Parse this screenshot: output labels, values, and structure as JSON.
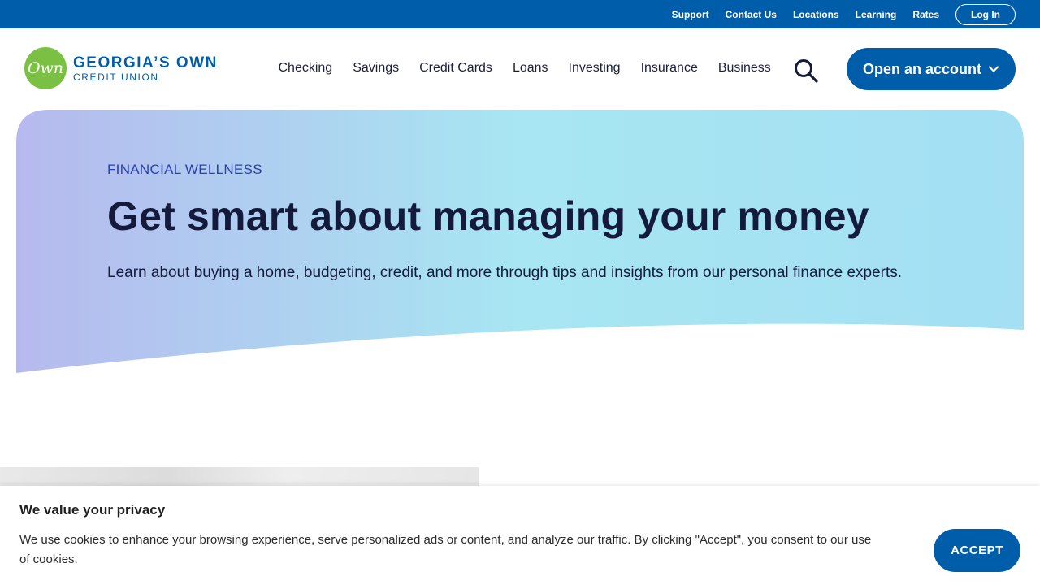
{
  "colors": {
    "brand_blue": "#005daa",
    "brand_green": "#7ac143",
    "heading_navy": "#141a3c",
    "eyebrow_blue": "#2a3fb0"
  },
  "utility_nav": {
    "links": [
      "Support",
      "Contact Us",
      "Locations",
      "Learning",
      "Rates"
    ],
    "login_label": "Log In"
  },
  "logo": {
    "mark": "Own",
    "line1": "GEORGIA’S OWN",
    "line2": "CREDIT UNION"
  },
  "main_nav": {
    "items": [
      "Checking",
      "Savings",
      "Credit Cards",
      "Loans",
      "Investing",
      "Insurance",
      "Business"
    ],
    "search_icon": "search-icon",
    "open_account_label": "Open an account",
    "open_account_icon": "chevron-down-icon"
  },
  "hero": {
    "eyebrow": "FINANCIAL WELLNESS",
    "title": "Get smart about managing your money",
    "description": "Learn about buying a home, budgeting, credit, and more through tips and insights from our personal finance experts."
  },
  "cookie_banner": {
    "title": "We value your privacy",
    "text": "We use cookies to enhance your browsing experience, serve personalized ads or content, and analyze our traffic. By clicking \"Accept\", you consent to our use of cookies.",
    "accept_label": "ACCEPT"
  }
}
